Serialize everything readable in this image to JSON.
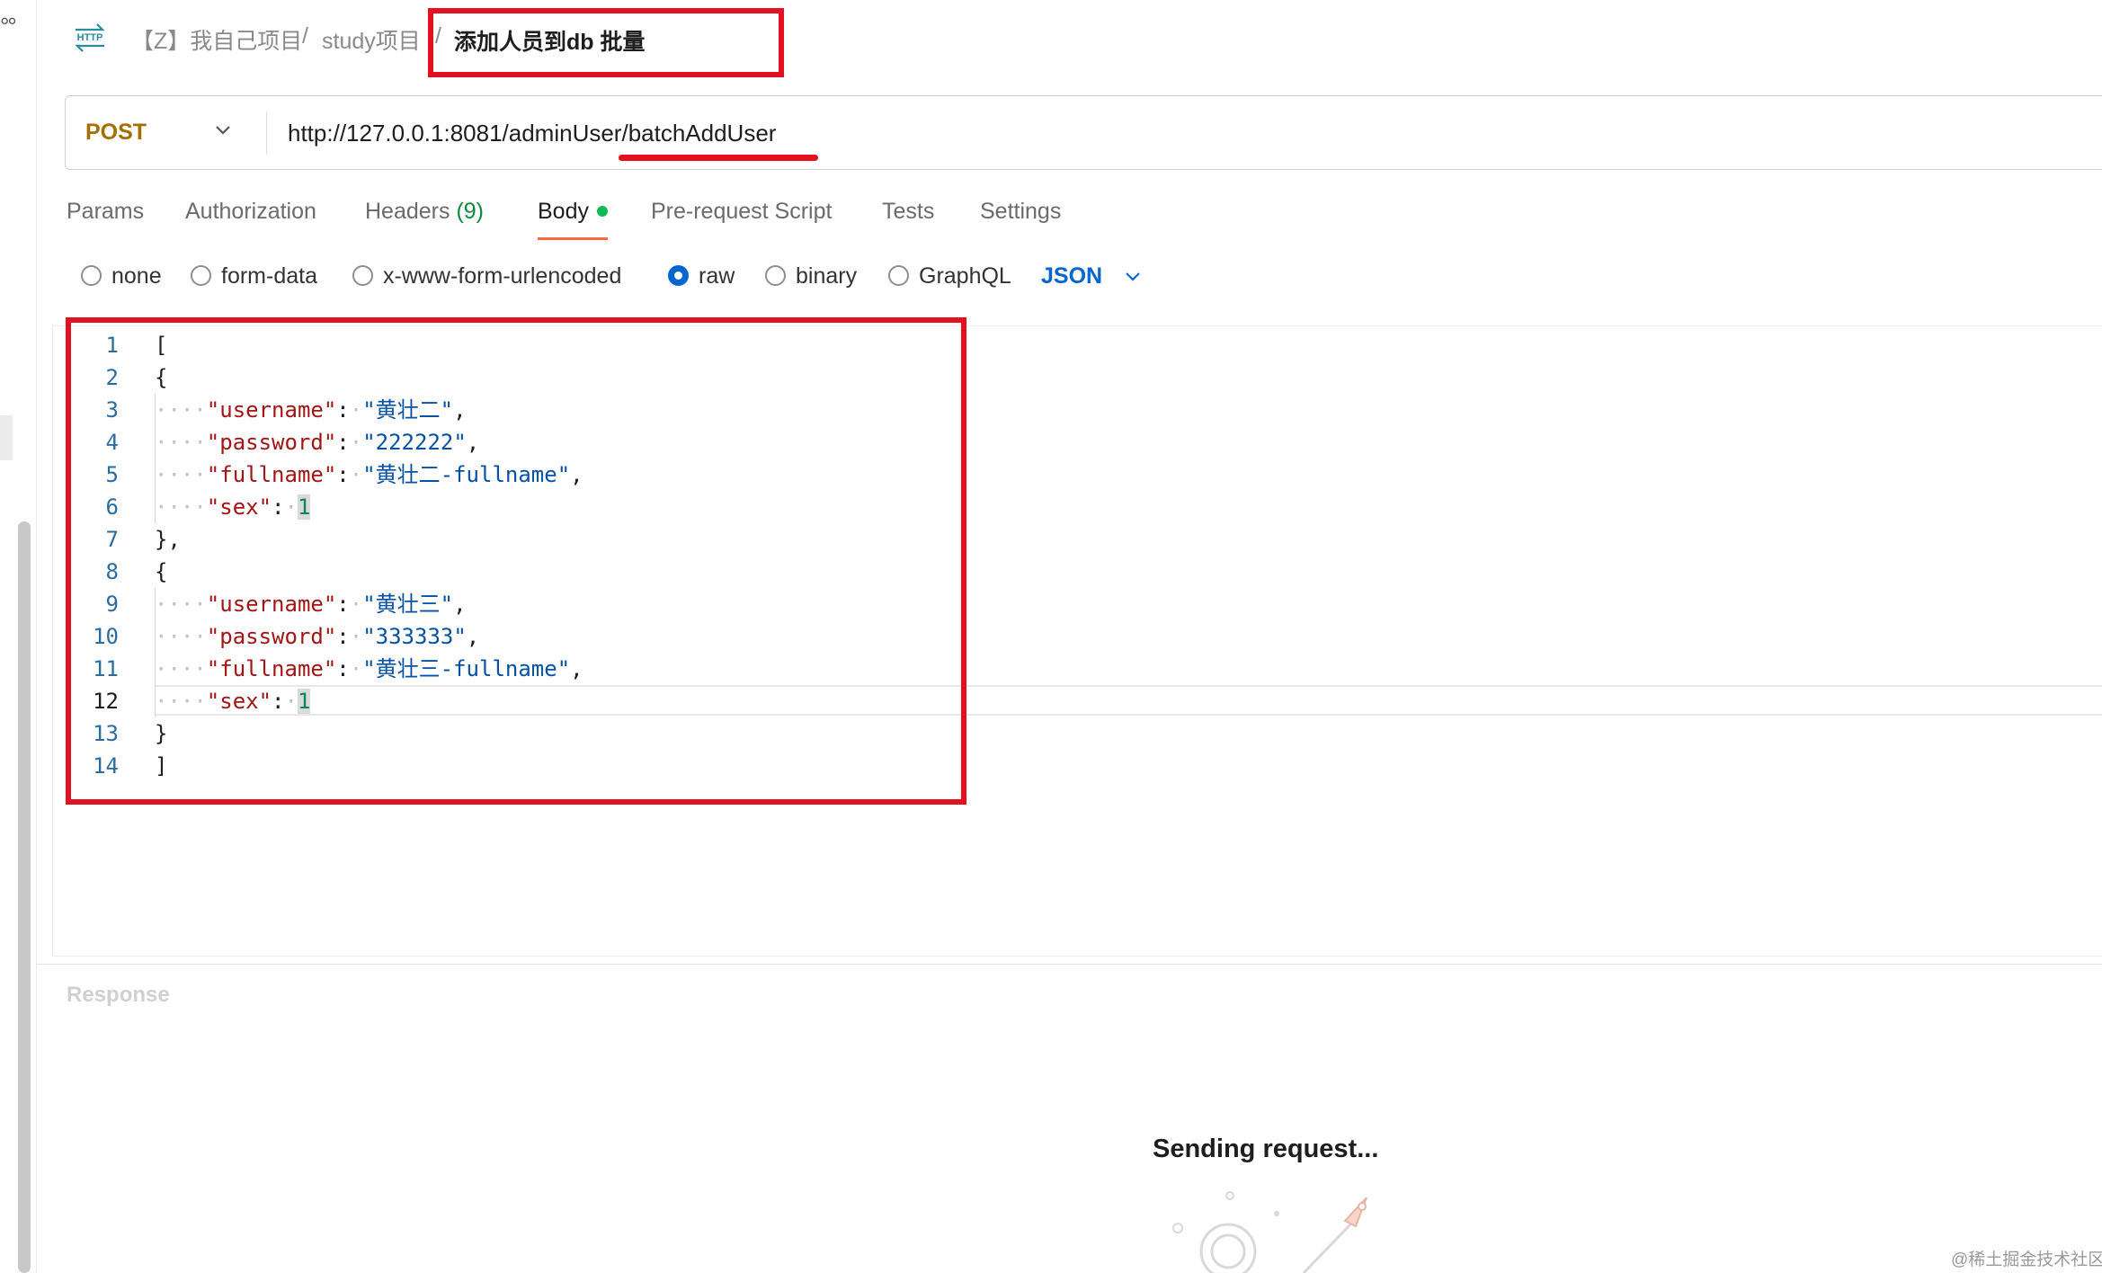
{
  "breadcrumb": {
    "workspace": "【Z】我自己项目",
    "separator": "/",
    "collection": "study项目",
    "request_name": "添加人员到db 批量"
  },
  "request": {
    "method": "POST",
    "url": "http://127.0.0.1:8081/adminUser/batchAddUser"
  },
  "tabs": [
    {
      "label": "Params"
    },
    {
      "label": "Authorization"
    },
    {
      "label": "Headers",
      "count": "(9)"
    },
    {
      "label": "Body",
      "active": true
    },
    {
      "label": "Pre-request Script"
    },
    {
      "label": "Tests"
    },
    {
      "label": "Settings"
    }
  ],
  "body_types": [
    "none",
    "form-data",
    "x-www-form-urlencoded",
    "raw",
    "binary",
    "GraphQL"
  ],
  "selected_body_type": "raw",
  "body_format": "JSON",
  "editor": {
    "current_line": 12,
    "lines": [
      {
        "n": "1",
        "text": "["
      },
      {
        "n": "2",
        "text": "{"
      },
      {
        "n": "3",
        "key": "\"username\"",
        "value": "\"黄壮二\"",
        "trail": ","
      },
      {
        "n": "4",
        "key": "\"password\"",
        "value": "\"222222\"",
        "trail": ","
      },
      {
        "n": "5",
        "key": "\"fullname\"",
        "value": "\"黄壮二-fullname\"",
        "trail": ","
      },
      {
        "n": "6",
        "key": "\"sex\"",
        "value": "1",
        "trail": ""
      },
      {
        "n": "7",
        "text": "},"
      },
      {
        "n": "8",
        "text": "{"
      },
      {
        "n": "9",
        "key": "\"username\"",
        "value": "\"黄壮三\"",
        "trail": ","
      },
      {
        "n": "10",
        "key": "\"password\"",
        "value": "\"333333\"",
        "trail": ","
      },
      {
        "n": "11",
        "key": "\"fullname\"",
        "value": "\"黄壮三-fullname\"",
        "trail": ","
      },
      {
        "n": "12",
        "key": "\"sex\"",
        "value": "1",
        "trail": ""
      },
      {
        "n": "13",
        "text": "}"
      },
      {
        "n": "14",
        "text": "]"
      }
    ]
  },
  "response": {
    "label": "Response",
    "status_text": "Sending request..."
  },
  "watermark": "@稀土掘金技术社区",
  "colors": {
    "method": "#a56f00",
    "annotation_red": "#e3101f",
    "accent_blue": "#0265d2",
    "tab_underline": "#ff6c37"
  }
}
